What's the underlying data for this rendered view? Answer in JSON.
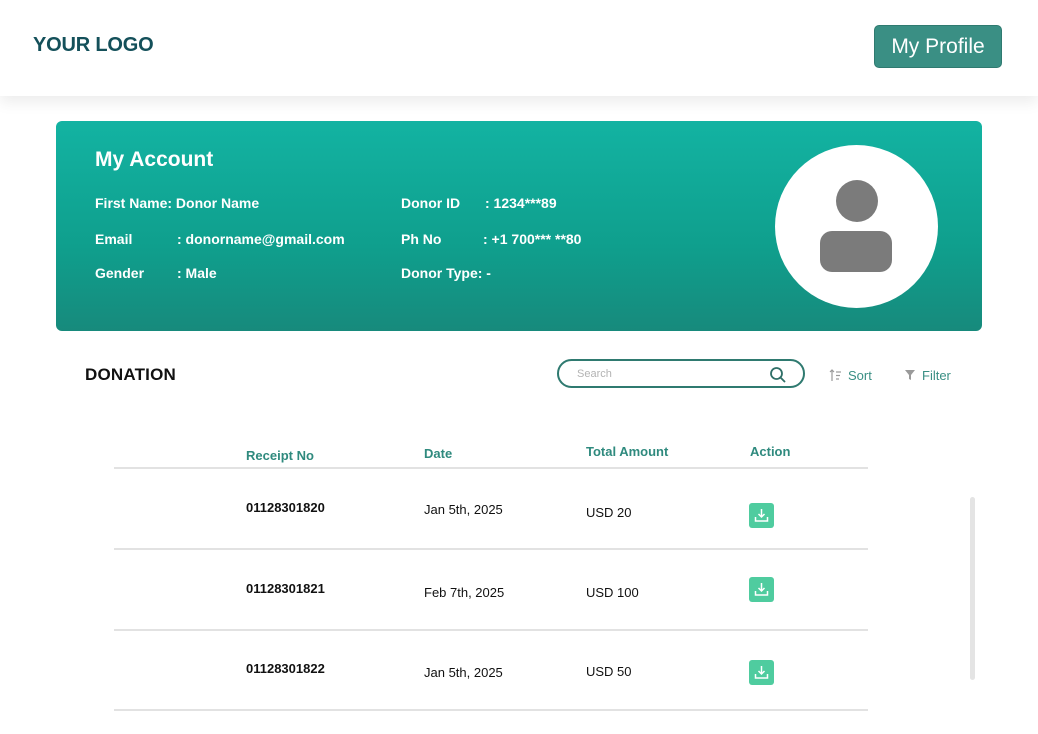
{
  "header": {
    "logo": "YOUR LOGO",
    "profile_button": "My Profile"
  },
  "account": {
    "title": "My Account",
    "first_name": "First Name: Donor Name",
    "email_label": "Email",
    "email_value": ": donorname@gmail.com",
    "gender_label": "Gender",
    "gender_value": ": Male",
    "donor_id_label": "Donor ID",
    "donor_id_value": ": 1234***89",
    "phone_label": "Ph No",
    "phone_value": ": +1 700*** **80",
    "donor_type": "Donor Type: -"
  },
  "donation": {
    "title": "DONATION",
    "search_placeholder": "Search",
    "sort_label": "Sort",
    "filter_label": "Filter",
    "columns": {
      "receipt": "Receipt No",
      "date": "Date",
      "amount": "Total Amount",
      "action": "Action"
    },
    "rows": [
      {
        "receipt": "01128301820",
        "date": "Jan 5th, 2025",
        "amount": "USD 20"
      },
      {
        "receipt": "01128301821",
        "date": "Feb 7th, 2025",
        "amount": "USD 100"
      },
      {
        "receipt": "01128301822",
        "date": "Jan 5th, 2025",
        "amount": "USD 50"
      }
    ]
  },
  "icons": {
    "search": "search-icon",
    "sort": "sort-icon",
    "filter": "filter-icon",
    "download": "download-icon",
    "avatar": "user-avatar-icon"
  },
  "colors": {
    "brand": "#3a8f84",
    "card_gradient_top": "#13b3a2",
    "card_gradient_bottom": "#178a7c",
    "download_button": "#4fcc9f",
    "logo": "#14505a"
  }
}
